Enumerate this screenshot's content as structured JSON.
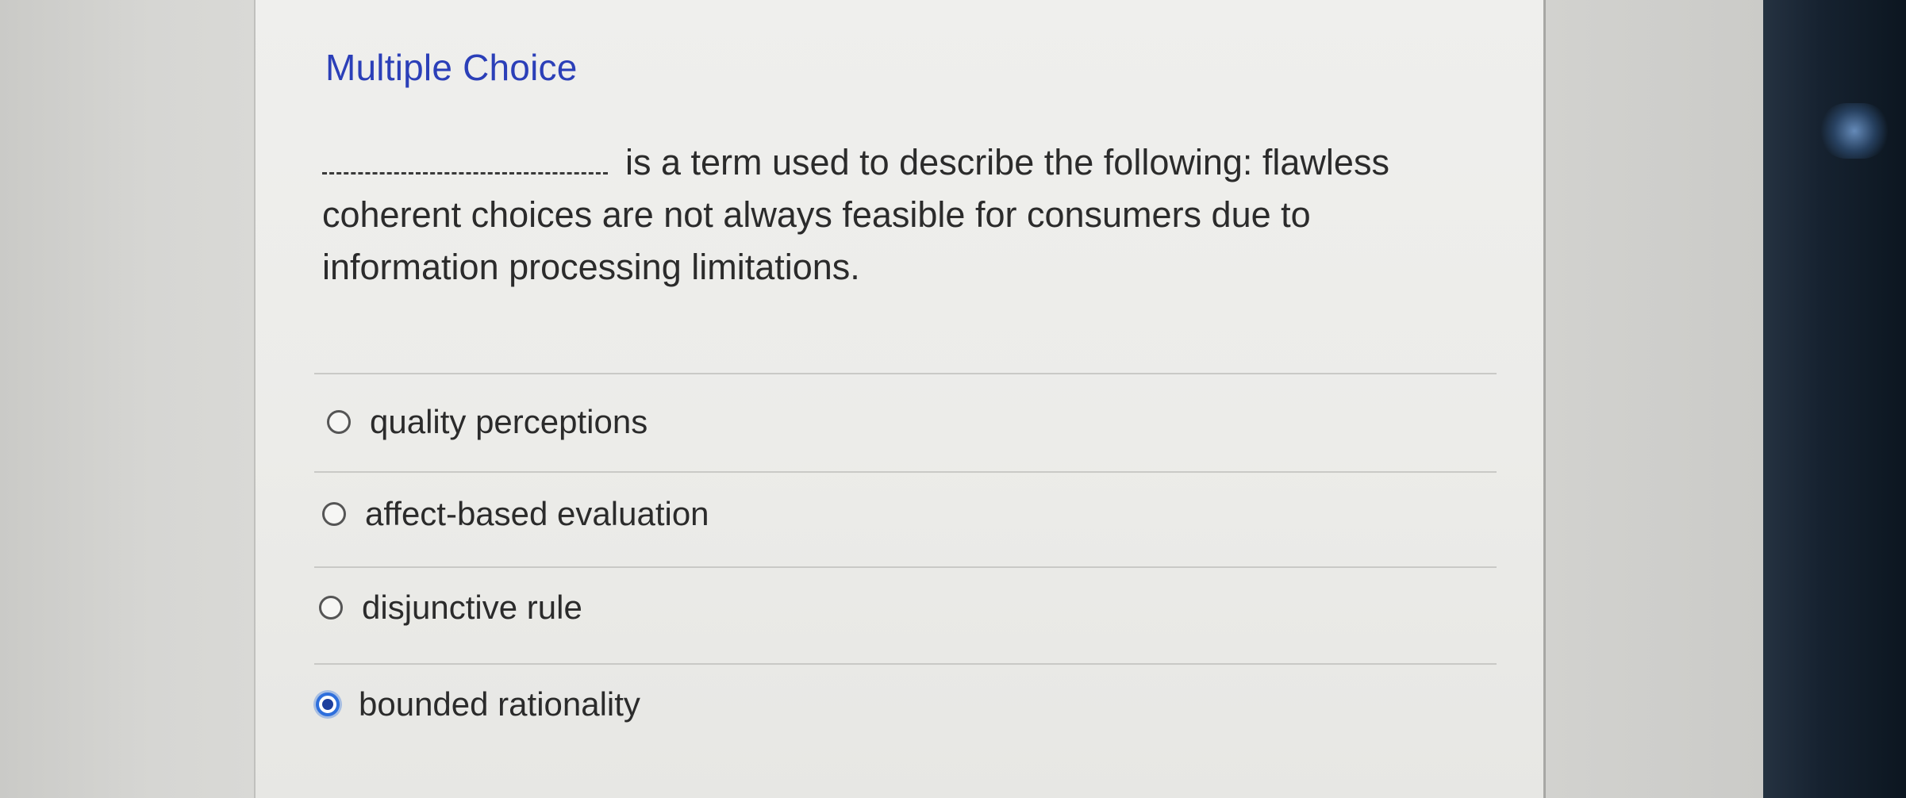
{
  "question": {
    "heading": "Multiple Choice",
    "text": "is a term used to describe the following: flawless coherent choices are not always feasible for consumers due to information processing limitations."
  },
  "options": [
    {
      "label": "quality perceptions",
      "selected": false
    },
    {
      "label": "affect-based evaluation",
      "selected": false
    },
    {
      "label": "disjunctive rule",
      "selected": false
    },
    {
      "label": "bounded rationality",
      "selected": true
    }
  ],
  "colors": {
    "heading": "#2b3fb8",
    "selected_radio": "#2e6fdc"
  }
}
